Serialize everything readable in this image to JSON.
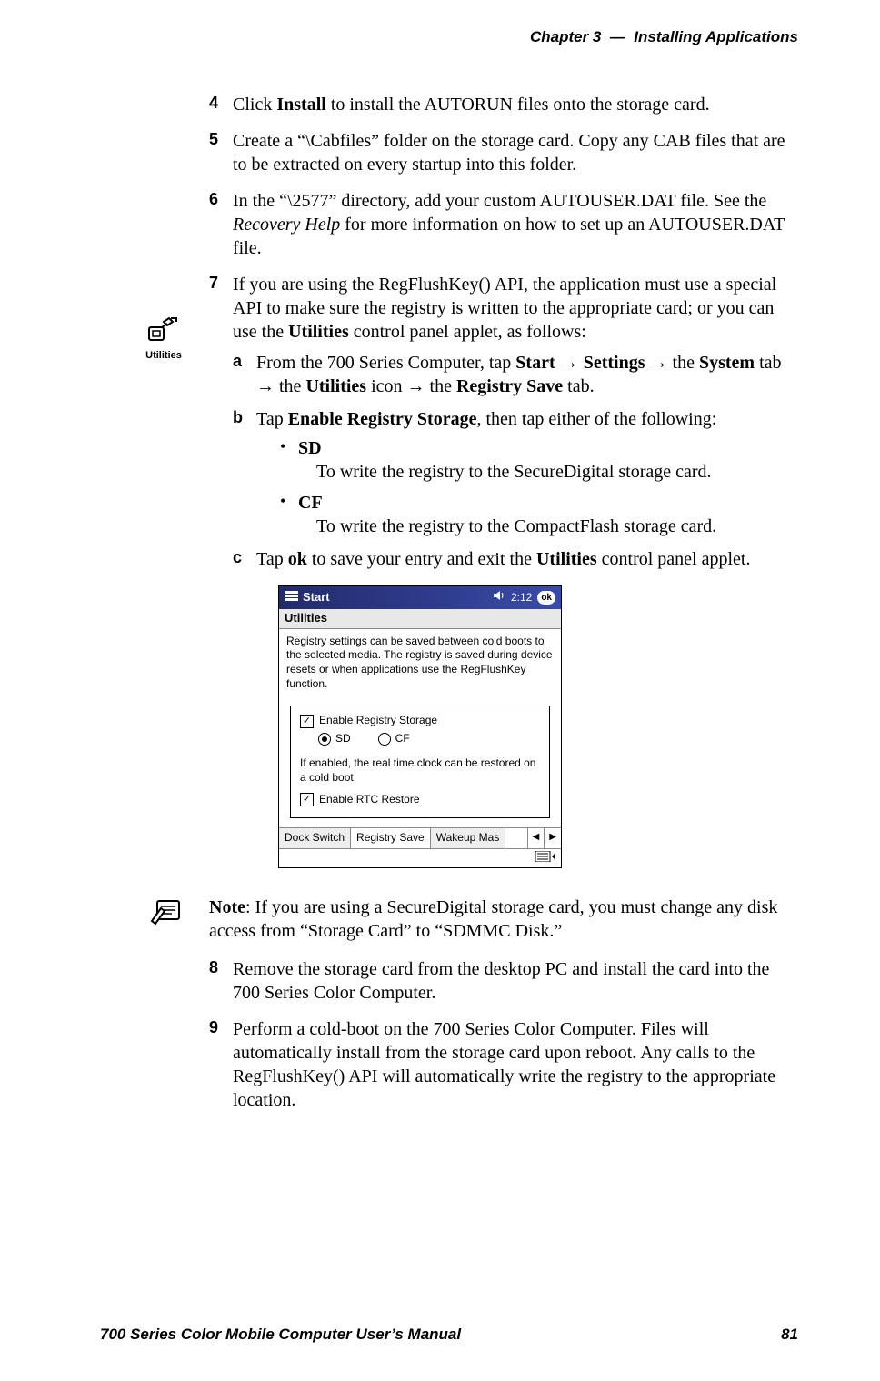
{
  "header": {
    "chapter_label": "Chapter  3",
    "dash": "—",
    "chapter_title": "Installing Applications"
  },
  "steps": {
    "s4": {
      "num": "4",
      "pre": "Click ",
      "bold1": "Install",
      "post": " to install the AUTORUN files onto the storage card."
    },
    "s5": {
      "num": "5",
      "text": "Create a “\\Cabfiles” folder on the storage card. Copy any CAB files that are to be extracted on every startup into this folder."
    },
    "s6": {
      "num": "6",
      "pre": "In the “\\2577” directory, add your custom AUTOUSER.DAT file. See the ",
      "ital": "Recovery Help",
      "post": " for more information on how to set up an AUTOUSER.DAT file."
    },
    "s7": {
      "num": "7",
      "pre": "If you are using the RegFlushKey() API, the application must use a special API to make sure the registry is written to the appropriate card; or you can use the ",
      "bold": "Utilities",
      "post": " control panel applet, as follows:"
    },
    "sub": {
      "a": {
        "marker": "a",
        "t1": "From the 700 Series Computer, tap ",
        "b1": "Start",
        "arrow": " → ",
        "b2": "Settings",
        "t2": " → the ",
        "b3": "System",
        "t3": " tab → the ",
        "b4": "Utilities",
        "t4": " icon → the ",
        "b5": "Registry Save",
        "t5": " tab."
      },
      "b": {
        "marker": "b",
        "t1": "Tap ",
        "b1": "Enable Registry Storage",
        "t2": ", then tap either of the following:"
      },
      "bullets": {
        "sd": {
          "label": "SD",
          "desc": "To write the registry to the SecureDigital storage card."
        },
        "cf": {
          "label": "CF",
          "desc": "To write the registry to the CompactFlash storage card."
        }
      },
      "c": {
        "marker": "c",
        "t1": "Tap ",
        "b1": "ok",
        "t2": " to save your entry and exit the ",
        "b2": "Utilities",
        "t3": " control panel applet."
      }
    },
    "s8": {
      "num": "8",
      "text": "Remove the storage card from the desktop PC and install the card into the 700 Series Color Computer."
    },
    "s9": {
      "num": "9",
      "text": "Perform a cold-boot on the 700 Series Color Computer. Files will automatically install from the storage card upon reboot. Any calls to the RegFlushKey() API will automatically write the registry to the appropriate location."
    }
  },
  "margin": {
    "utilities_label": "Utilities"
  },
  "note": {
    "lead": "Note",
    "text": ": If you are using a SecureDigital storage card, you must change any disk access from “Storage Card” to “SDMMC Disk.”"
  },
  "pda": {
    "start": "Start",
    "time": "2:12",
    "ok": "ok",
    "app": "Utilities",
    "desc": "Registry settings can be saved between cold boots to the selected media. The registry is saved during device resets or when applications use the RegFlushKey function.",
    "chk1": "Enable Registry Storage",
    "radio_sd": "SD",
    "radio_cf": "CF",
    "rtc_hint": "If enabled, the real time clock can be restored on a cold boot",
    "chk2": "Enable RTC Restore",
    "tabs": {
      "t1": "Dock Switch",
      "t2": "Registry Save",
      "t3": "Wakeup Mas"
    }
  },
  "footer": {
    "title": "700 Series Color Mobile Computer User’s Manual",
    "page": "81"
  }
}
